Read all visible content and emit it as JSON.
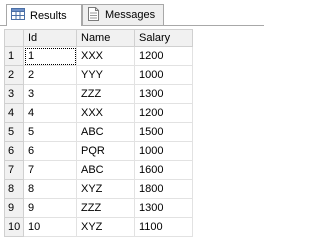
{
  "tabs": [
    {
      "label": "Results",
      "icon": "grid-icon",
      "active": true
    },
    {
      "label": "Messages",
      "icon": "messages-icon",
      "active": false
    }
  ],
  "columns": [
    "Id",
    "Name",
    "Salary"
  ],
  "rows": [
    {
      "num": "1",
      "id": "1",
      "name": "XXX",
      "salary": "1200"
    },
    {
      "num": "2",
      "id": "2",
      "name": "YYY",
      "salary": "1000"
    },
    {
      "num": "3",
      "id": "3",
      "name": "ZZZ",
      "salary": "1300"
    },
    {
      "num": "4",
      "id": "4",
      "name": "XXX",
      "salary": "1200"
    },
    {
      "num": "5",
      "id": "5",
      "name": "ABC",
      "salary": "1500"
    },
    {
      "num": "6",
      "id": "6",
      "name": "PQR",
      "salary": "1000"
    },
    {
      "num": "7",
      "id": "7",
      "name": "ABC",
      "salary": "1600"
    },
    {
      "num": "8",
      "id": "8",
      "name": "XYZ",
      "salary": "1800"
    },
    {
      "num": "9",
      "id": "9",
      "name": "ZZZ",
      "salary": "1300"
    },
    {
      "num": "10",
      "id": "10",
      "name": "XYZ",
      "salary": "1100"
    }
  ]
}
